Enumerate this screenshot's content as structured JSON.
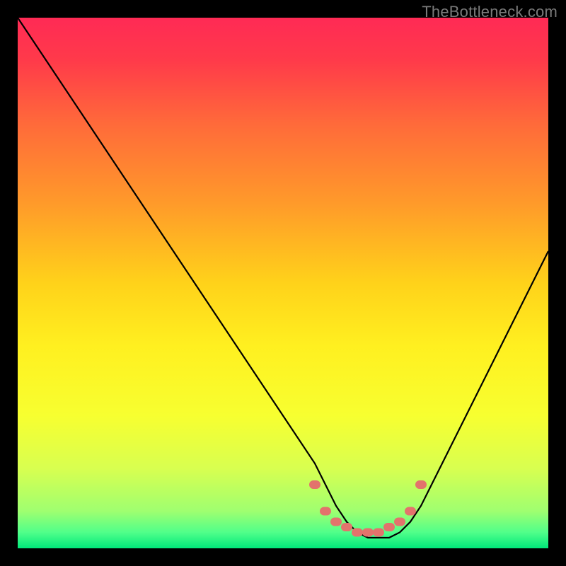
{
  "watermark": "TheBottleneck.com",
  "colors": {
    "gradient_stops": [
      {
        "offset": 0.0,
        "color": "#ff2a55"
      },
      {
        "offset": 0.08,
        "color": "#ff3a4a"
      },
      {
        "offset": 0.2,
        "color": "#ff6a3a"
      },
      {
        "offset": 0.35,
        "color": "#ff9a2a"
      },
      {
        "offset": 0.5,
        "color": "#ffd21a"
      },
      {
        "offset": 0.62,
        "color": "#fff020"
      },
      {
        "offset": 0.75,
        "color": "#f7ff30"
      },
      {
        "offset": 0.85,
        "color": "#d8ff50"
      },
      {
        "offset": 0.93,
        "color": "#9fff70"
      },
      {
        "offset": 0.97,
        "color": "#50ff8a"
      },
      {
        "offset": 1.0,
        "color": "#00e87a"
      }
    ],
    "curve": "#000000",
    "marker": "#e3736c",
    "background": "#000000"
  },
  "chart_data": {
    "type": "line",
    "title": "",
    "xlabel": "",
    "ylabel": "",
    "xlim": [
      0,
      100
    ],
    "ylim": [
      0,
      100
    ],
    "grid": false,
    "legend": false,
    "series": [
      {
        "name": "bottleneck-curve",
        "x": [
          0,
          4,
          8,
          12,
          16,
          20,
          24,
          28,
          32,
          36,
          40,
          44,
          48,
          52,
          56,
          58,
          60,
          62,
          64,
          66,
          68,
          70,
          72,
          74,
          76,
          78,
          82,
          86,
          90,
          94,
          98,
          100
        ],
        "y": [
          100,
          94,
          88,
          82,
          76,
          70,
          64,
          58,
          52,
          46,
          40,
          34,
          28,
          22,
          16,
          12,
          8,
          5,
          3,
          2,
          2,
          2,
          3,
          5,
          8,
          12,
          20,
          28,
          36,
          44,
          52,
          56
        ]
      }
    ],
    "markers": {
      "name": "bottom-cluster",
      "x": [
        56,
        58,
        60,
        62,
        64,
        66,
        68,
        70,
        72,
        74,
        76
      ],
      "y": [
        12,
        7,
        5,
        4,
        3,
        3,
        3,
        4,
        5,
        7,
        12
      ]
    }
  }
}
